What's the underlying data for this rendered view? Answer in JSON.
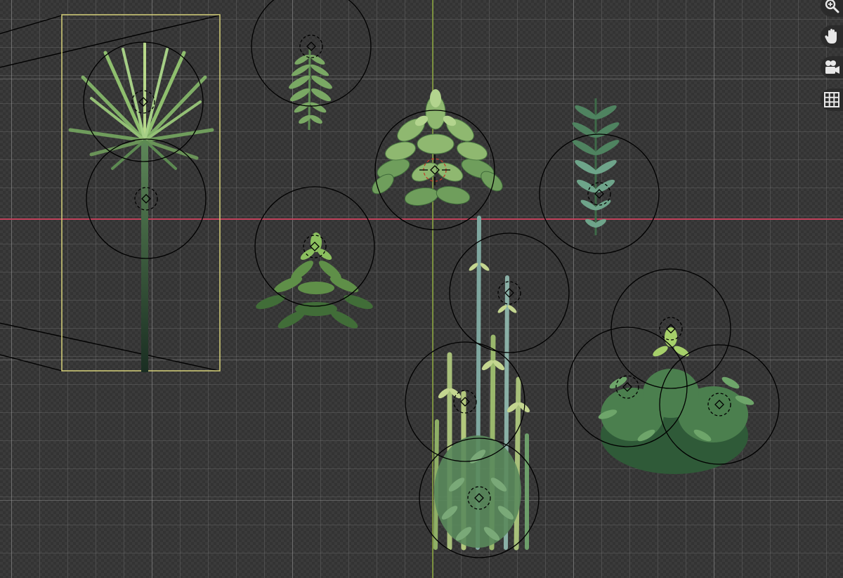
{
  "viewport": {
    "background_color": "#3a3a3a",
    "x_axis_color": "#c0405a",
    "y_axis_color": "#8aa63a",
    "selection_color": "#d8d27a",
    "guide_color": "#000000"
  },
  "toolbar": {
    "tools": [
      {
        "id": "zoom",
        "icon": "zoom-magnifier-icon"
      },
      {
        "id": "pan",
        "icon": "pan-hand-icon"
      },
      {
        "id": "camera",
        "icon": "camera-view-icon"
      },
      {
        "id": "grid",
        "icon": "grid-toggle-icon"
      }
    ]
  },
  "plants": [
    {
      "name": "plant-fan-palm",
      "kind": "palm",
      "selected": true
    },
    {
      "name": "plant-small-fern",
      "kind": "fern"
    },
    {
      "name": "plant-succulent-cluster",
      "kind": "succulent",
      "active": true
    },
    {
      "name": "plant-hanging-fern",
      "kind": "fern-hanging"
    },
    {
      "name": "plant-low-shrub",
      "kind": "shrub"
    },
    {
      "name": "plant-tall-stalks",
      "kind": "stalks"
    },
    {
      "name": "plant-bush-cluster",
      "kind": "bush"
    }
  ]
}
